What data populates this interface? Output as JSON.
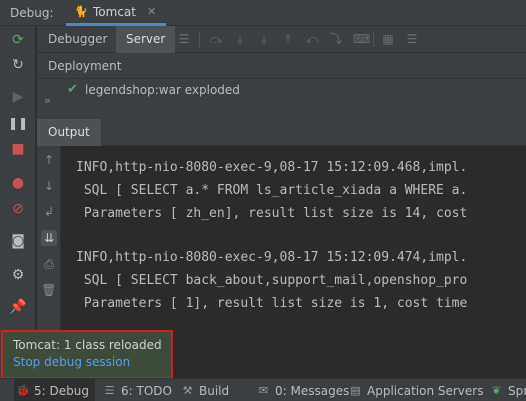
{
  "window": {
    "debug_label": "Debug:",
    "tab": {
      "icon": "tomcat-icon",
      "label": "Tomcat",
      "close_icon": "close-icon"
    }
  },
  "left_toolbar": {
    "icons": [
      "rerun-icon",
      "restart-icon",
      "resume-icon",
      "pause-icon",
      "stop-icon",
      "view-breakpoints-icon",
      "mute-breakpoints-icon",
      "camera-icon",
      "settings-icon",
      "pin-icon"
    ]
  },
  "subtabs": {
    "debugger": "Debugger",
    "server": "Server"
  },
  "toolbar_icons": [
    "menu-icon",
    "step-over-icon",
    "step-into-icon",
    "force-step-into-icon",
    "step-out-icon",
    "drop-frame-icon",
    "run-to-cursor-icon",
    "evaluate-icon",
    "table-icon",
    "list-icon"
  ],
  "deployment": {
    "header": "Deployment",
    "expand_icon": "double-chevron-icon",
    "status_icon": "check-icon",
    "artifact": "legendshop:war exploded"
  },
  "output": {
    "header": "Output",
    "gutter_icons": [
      "up-arrow-icon",
      "down-arrow-icon",
      "soft-wrap-icon",
      "scroll-to-end-icon",
      "print-icon",
      "trash-icon"
    ],
    "lines": [
      "INFO,http-nio-8080-exec-9,08-17 15:12:09.468,impl.",
      " SQL [ SELECT a.* FROM ls_article_xiada a WHERE a.",
      " Parameters [ zh_en], result list size is 14, cost",
      "",
      "INFO,http-nio-8080-exec-9,08-17 15:12:09.474,impl.",
      " SQL [ SELECT back_about,support_mail,openshop_pro",
      " Parameters [ 1], result list size is 1, cost time"
    ]
  },
  "notification": {
    "title": "Tomcat: 1 class reloaded",
    "link": "Stop debug session"
  },
  "bottom_bar": {
    "items": [
      {
        "icon": "bug-icon",
        "label": "5: Debug"
      },
      {
        "icon": "todo-icon",
        "label": "6: TODO"
      },
      {
        "icon": "build-icon",
        "label": "Build"
      },
      {
        "icon": "messages-icon",
        "label": "0: Messages"
      },
      {
        "icon": "server-icon",
        "label": "Application Servers"
      },
      {
        "icon": "spring-icon",
        "label": "Spr"
      }
    ]
  },
  "colors": {
    "accent": "#4a88c7",
    "check": "#59a869",
    "link": "#589df6",
    "highlight_border": "#d21e1e"
  }
}
